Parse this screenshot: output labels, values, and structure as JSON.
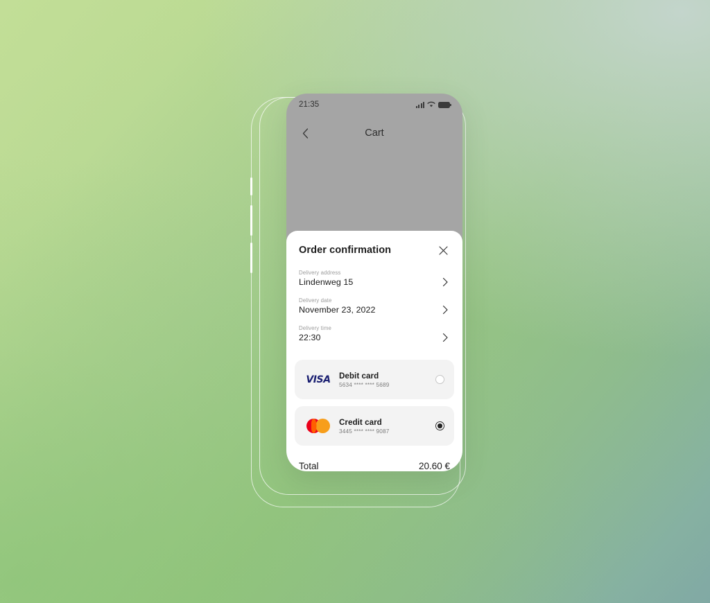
{
  "background": {
    "gradient_from": "#c2de97",
    "gradient_mid": "#93c37d",
    "gradient_to": "#81a9a4",
    "tint_top_right": "#c6d6d0"
  },
  "phone": {
    "status_bar": {
      "time": "21:35",
      "icons": [
        "signal-bars-icon",
        "wifi-icon",
        "battery-icon"
      ]
    },
    "nav_bar": {
      "back_icon": "chevron-left-icon",
      "title": "Cart"
    }
  },
  "sheet": {
    "title": "Order confirmation",
    "close_icon": "close-icon",
    "details": [
      {
        "label": "Delivery address",
        "value": "Lindenweg 15",
        "chevron": "chevron-right-icon"
      },
      {
        "label": "Delivery date",
        "value": "November 23, 2022",
        "chevron": "chevron-right-icon"
      },
      {
        "label": "Delivery time",
        "value": "22:30",
        "chevron": "chevron-right-icon"
      }
    ],
    "payment_methods": [
      {
        "brand": "visa-logo",
        "brand_text": "VISA",
        "name": "Debit card",
        "number": "5634 **** **** 5689",
        "selected": false,
        "brand_color": "#1a1f71"
      },
      {
        "brand": "mastercard-logo",
        "brand_text": "",
        "name": "Credit card",
        "number": "3445 **** **** 9087",
        "selected": true,
        "brand_color": "#eb001b"
      }
    ],
    "total": {
      "label": "Total",
      "value": "20.60 €"
    }
  }
}
